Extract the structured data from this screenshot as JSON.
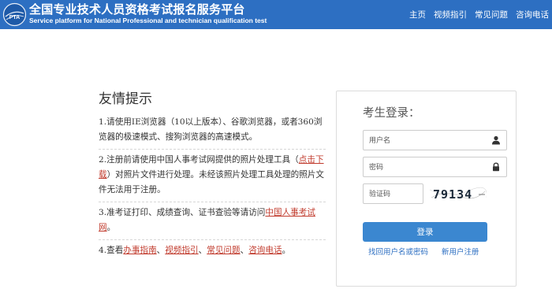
{
  "header": {
    "title_cn": "全国专业技术人员资格考试报名服务平台",
    "title_en": "Service platform for National Professional and technician qualification test",
    "logo_text": "PTA",
    "nav": [
      "主页",
      "视频指引",
      "常见问题",
      "咨询电话"
    ]
  },
  "tips": {
    "title": "友情提示",
    "item1": "1.请使用IE浏览器（10以上版本）、谷歌浏览器，或者360浏览器的极速模式、搜狗浏览器的高速模式。",
    "item2_a": "2.注册前请使用中国人事考试网提供的照片处理工具（",
    "item2_link": "点击下载",
    "item2_b": "）对照片文件进行处理。未经该照片处理工具处理的照片文件无法用于注册。",
    "item3_a": "3.准考证打印、成绩查询、证书查验等请访问",
    "item3_link": "中国人事考试网",
    "item3_b": "。",
    "item4_a": "4.查看",
    "item4_link1": "办事指南",
    "item4_sep1": "、",
    "item4_link2": "视频指引",
    "item4_sep2": "、",
    "item4_link3": "常见问题",
    "item4_sep3": "、",
    "item4_link4": "咨询电话",
    "item4_b": "。"
  },
  "login": {
    "title": "考生登录：",
    "username_placeholder": "用户名",
    "password_placeholder": "密码",
    "captcha_placeholder": "验证码",
    "captcha_text": "79134",
    "login_button": "登录",
    "forgot_link": "找回用户名或密码",
    "register_link": "新用户注册"
  },
  "colors": {
    "header": "#2d6fc2",
    "button": "#3b87d0",
    "link_red": "#c0392b"
  }
}
